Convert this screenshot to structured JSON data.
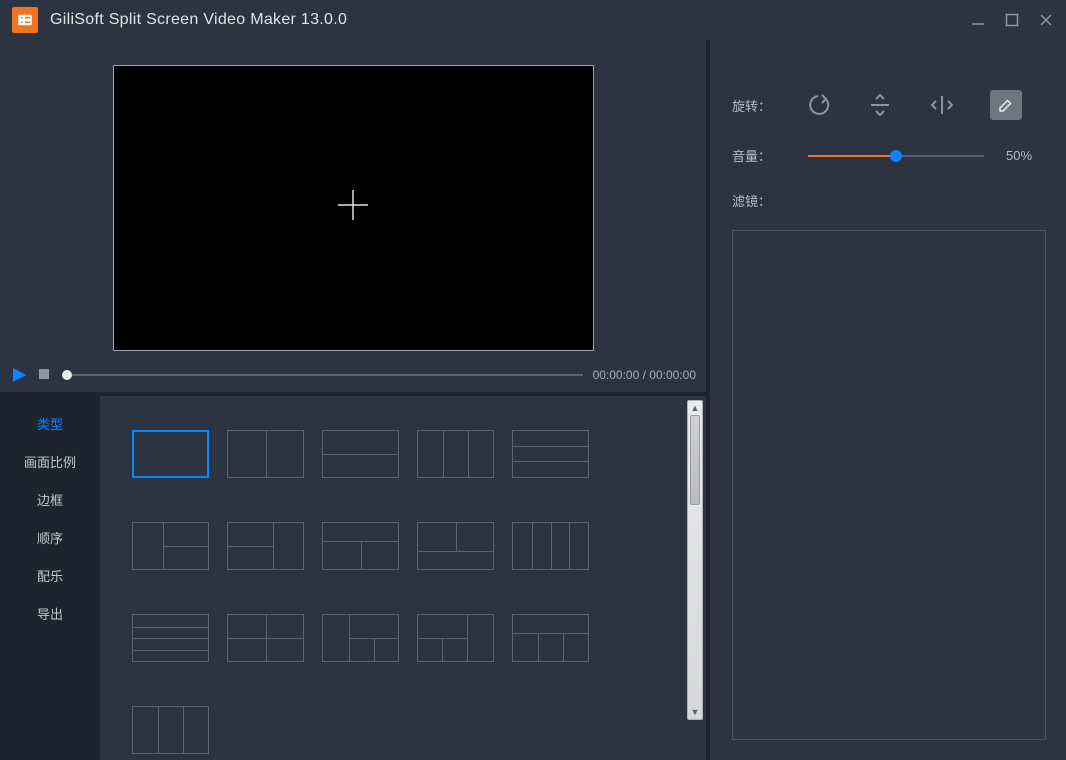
{
  "title": "GiliSoft Split Screen Video Maker 13.0.0",
  "player": {
    "time": "00:00:00 / 00:00:00"
  },
  "sidenav": {
    "items": [
      {
        "label": "类型",
        "active": true
      },
      {
        "label": "画面比例"
      },
      {
        "label": "边框"
      },
      {
        "label": "顺序"
      },
      {
        "label": "配乐"
      },
      {
        "label": "导出"
      }
    ]
  },
  "rightpanel": {
    "rotate_label": "旋转：",
    "volume_label": "音量：",
    "volume_value": "50%",
    "filter_label": "滤镜："
  }
}
